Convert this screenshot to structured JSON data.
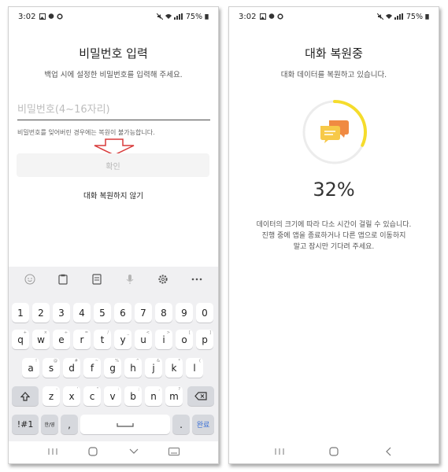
{
  "left": {
    "status": {
      "time": "3:02",
      "battery": "75%"
    },
    "title": "비밀번호 입력",
    "subtitle": "백업 시에 설정한 비밀번호를 입력해 주세요.",
    "password_placeholder": "비밀번호(4~16자리)",
    "notice": "비밀번호를 잊어버린 경우에는 복원이 불가능합니다.",
    "confirm_label": "확인",
    "skip_label": "대화 복원하지 않기"
  },
  "keyboard": {
    "toolbar_icons": [
      "emoji-icon",
      "clipboard-icon",
      "text-edit-icon",
      "microphone-icon",
      "gear-icon",
      "more-icon"
    ],
    "number_row": [
      "1",
      "2",
      "3",
      "4",
      "5",
      "6",
      "7",
      "8",
      "9",
      "0"
    ],
    "row1": [
      {
        "k": "q",
        "s": "+"
      },
      {
        "k": "w",
        "s": "×"
      },
      {
        "k": "e",
        "s": "÷"
      },
      {
        "k": "r",
        "s": "="
      },
      {
        "k": "t",
        "s": "/"
      },
      {
        "k": "y",
        "s": "_"
      },
      {
        "k": "u",
        "s": "<"
      },
      {
        "k": "i",
        "s": ">"
      },
      {
        "k": "o",
        "s": "["
      },
      {
        "k": "p",
        "s": "]"
      }
    ],
    "row2": [
      {
        "k": "a",
        "s": "!"
      },
      {
        "k": "s",
        "s": "@"
      },
      {
        "k": "d",
        "s": "#"
      },
      {
        "k": "f",
        "s": "~"
      },
      {
        "k": "g",
        "s": "%"
      },
      {
        "k": "h",
        "s": "^"
      },
      {
        "k": "j",
        "s": "&"
      },
      {
        "k": "k",
        "s": "*"
      },
      {
        "k": "l",
        "s": "("
      }
    ],
    "row3": [
      {
        "k": "z",
        "s": "-"
      },
      {
        "k": "x",
        "s": "'"
      },
      {
        "k": "c",
        "s": "\""
      },
      {
        "k": "v",
        "s": ":"
      },
      {
        "k": "b",
        "s": ";"
      },
      {
        "k": "n",
        "s": ","
      },
      {
        "k": "m",
        "s": "?"
      }
    ],
    "symbols_label": "!#1",
    "lang_label": "한/영",
    "comma_label": ",",
    "period_label": ".",
    "done_label": "완료"
  },
  "right": {
    "status": {
      "time": "3:02",
      "battery": "75%"
    },
    "title": "대화 복원중",
    "subtitle": "대화 데이터를 복원하고 있습니다.",
    "percent_text": "32%",
    "progress": 0.32,
    "desc_line1": "데이터의 크기에 따라 다소 시간이 걸릴 수 있습니다.",
    "desc_line2": "진행 중에 앱을 종료하거나 다른 앱으로 이동하지",
    "desc_line3": "말고 잠시만 기다려 주세요."
  },
  "colors": {
    "progress_arc": "#f5dc2c",
    "progress_track": "#ececec",
    "bubble_back": "#f08a42",
    "bubble_front": "#f7c948",
    "arrow": "#d83a3a"
  }
}
